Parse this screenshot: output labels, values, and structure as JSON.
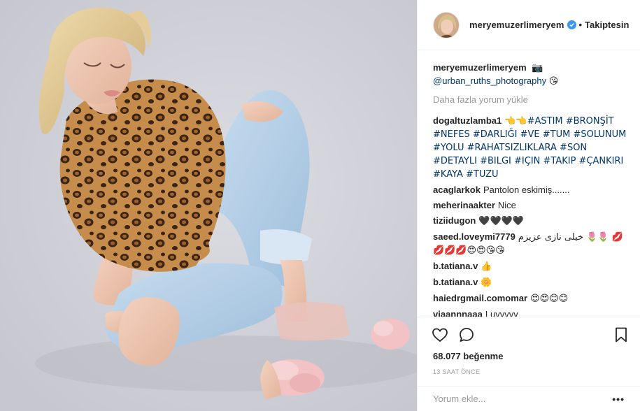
{
  "post": {
    "author": "meryemuzerlimeryem",
    "follow_status": "Takiptesin",
    "separator": "•",
    "caption": {
      "username": "meryemuzerlimeryem",
      "emoji": "📷",
      "mention": "@urban_ruths_photography",
      "emoji2": "😘"
    },
    "load_more": "Daha fazla yorum yükle",
    "comments": [
      {
        "username": "dogaltuzlamba1",
        "text": "👈👈#ASTIM #BRONŞİT #NEFES #DARLIĞI #VE #TUM #SOLUNUM #YOLU #RAHATSIZLIKLARA #SON #DETAYLI #BILGI #IÇIN #TAKIP #ÇANKIRI #KAYA #TUZU"
      },
      {
        "username": "acaglarkok",
        "text": "Pantolon eskimiş......."
      },
      {
        "username": "meherinaakter",
        "text": "Nice"
      },
      {
        "username": "tiziidugon",
        "text": "🖤🖤🖤🖤"
      },
      {
        "username": "saeed.loveymi7779",
        "text": "خیلی نازی عزیزم 🌷🌷 💋💋💋💋😍😍😘😘"
      },
      {
        "username": "b.tatiana.v",
        "text": "👍"
      },
      {
        "username": "b.tatiana.v",
        "text": "🌼"
      },
      {
        "username": "haiedrgmail.comomar",
        "text": "😍😍😊😊"
      },
      {
        "username": "viaannnaaa",
        "text": "Luvvvvv"
      }
    ],
    "likes": "68.077 beğenme",
    "time": "13 SAAT ÖNCE",
    "add_comment_placeholder": "Yorum ekle...",
    "more_options": "•••",
    "icons": {
      "like": "heart-icon",
      "comment": "comment-bubble-icon",
      "save": "bookmark-icon",
      "verified": "verified-badge-icon",
      "camera": "camera-emoji"
    },
    "colors": {
      "link": "#003569",
      "verified": "#3897f0",
      "muted": "#999999",
      "text": "#262626"
    }
  }
}
